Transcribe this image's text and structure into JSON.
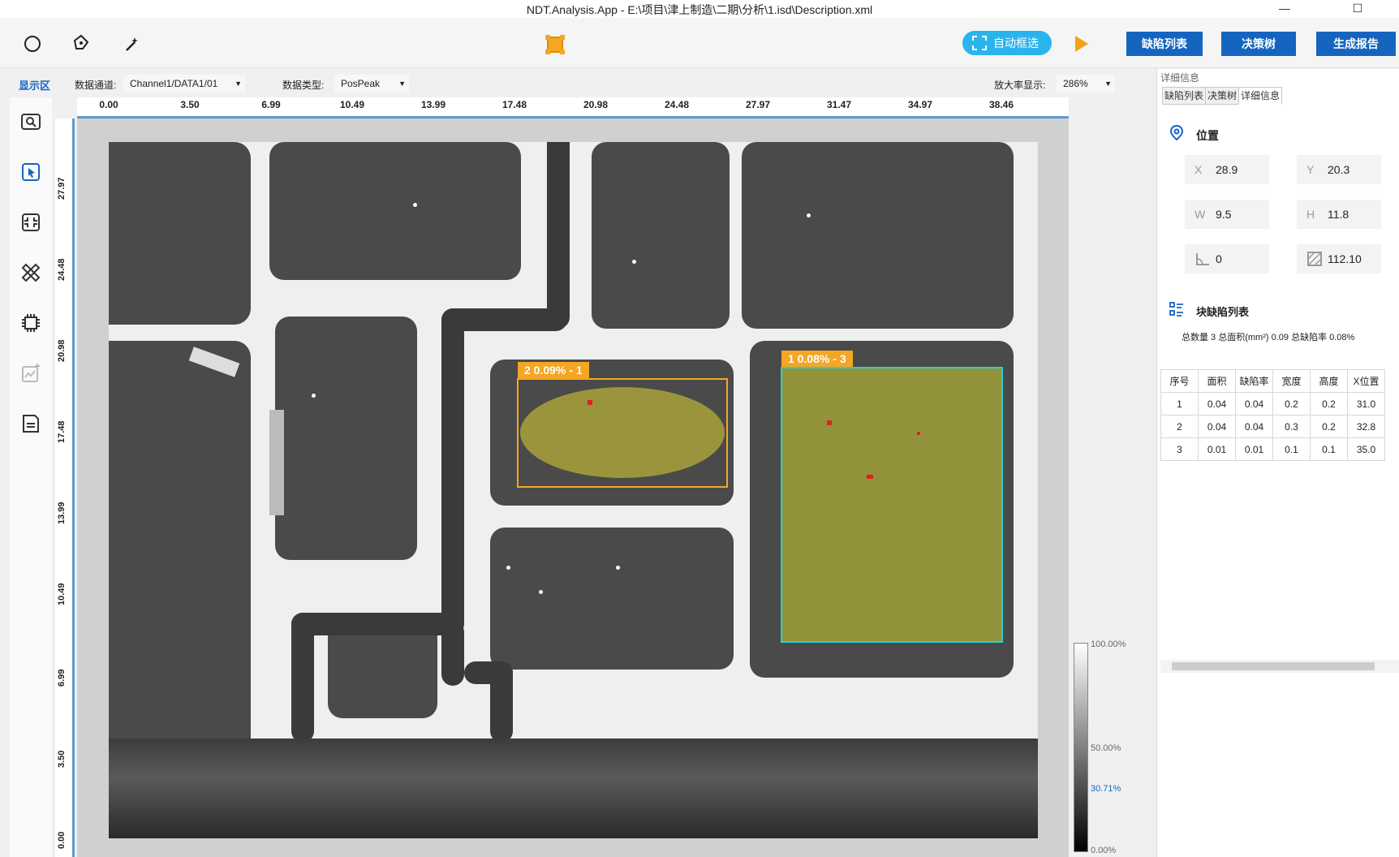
{
  "window": {
    "title": "NDT.Analysis.App  -  E:\\项目\\津上制造\\二期\\分析\\1.isd\\Description.xml",
    "minimize": "—",
    "maximize": "☐"
  },
  "toolbar": {
    "tools": [
      "circle-tool-icon",
      "pen-tool-icon",
      "magic-wand-icon"
    ],
    "auto_select_label": "自动框选",
    "defect_list_label": "缺陷列表",
    "decision_tree_label": "决策树",
    "report_label": "生成报告",
    "accent": "#1565c0",
    "auto_color": "#2ab4ee"
  },
  "display": {
    "area_label": "显示区",
    "channel_label": "数据通道:",
    "channel_value": "Channel1/DATA1/01",
    "type_label": "数据类型:",
    "type_value": "PosPeak",
    "zoom_label": "放大率显示:",
    "zoom_value": "286%"
  },
  "ruler": {
    "x_ticks": [
      "0.00",
      "3.50",
      "6.99",
      "10.49",
      "13.99",
      "17.48",
      "20.98",
      "24.48",
      "27.97",
      "31.47",
      "34.97",
      "38.46"
    ],
    "y_ticks": [
      "27.97",
      "24.48",
      "20.98",
      "17.48",
      "13.99",
      "10.49",
      "6.99",
      "3.50",
      "0.00"
    ]
  },
  "defects": [
    {
      "label": "2  0.09% - 1",
      "shape": "ellipse",
      "color": "#f5a623"
    },
    {
      "label": "1  0.08% - 3",
      "shape": "rect",
      "color": "#2ad0d0"
    }
  ],
  "colorbar": {
    "ticks": [
      "100.00%",
      "50.00%",
      "30.71%",
      "0.00%"
    ]
  },
  "panel": {
    "header": "详细信息",
    "tabs": [
      "缺陷列表",
      "决策树",
      "详细信息"
    ],
    "position_title": "位置",
    "fields": {
      "x_label": "X",
      "x_value": "28.9",
      "y_label": "Y",
      "y_value": "20.3",
      "w_label": "W",
      "w_value": "9.5",
      "h_label": "H",
      "h_value": "11.8",
      "angle_value": "0",
      "area_value": "112.10"
    },
    "list_title": "块缺陷列表",
    "summary": "总数量  3    总面积(mm²)  0.09    总缺陷率  0.08%",
    "columns": [
      "序号",
      "面积",
      "缺陷率",
      "宽度",
      "高度",
      "X位置"
    ],
    "rows": [
      [
        "1",
        "0.04",
        "0.04",
        "0.2",
        "0.2",
        "31.0"
      ],
      [
        "2",
        "0.04",
        "0.04",
        "0.3",
        "0.2",
        "32.8"
      ],
      [
        "3",
        "0.01",
        "0.01",
        "0.1",
        "0.1",
        "35.0"
      ]
    ]
  }
}
